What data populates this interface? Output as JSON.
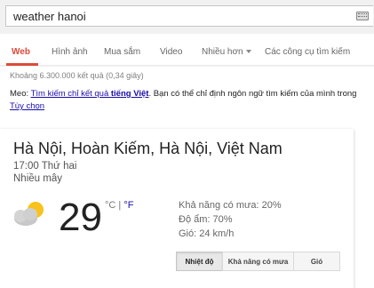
{
  "search": {
    "query": "weather hanoi"
  },
  "tabs": [
    "Web",
    "Hình ảnh",
    "Mua sắm",
    "Video",
    "Nhiều hơn",
    "Các công cụ tìm kiếm"
  ],
  "stats": "Khoảng 6.300.000 kết quả (0,34 giây)",
  "tip": {
    "prefix": "Meo: ",
    "link1": "Tìm kiếm chỉ kết quả ",
    "link1_bold": "tiếng Việt",
    "middle": ". Bạn có thể chỉ định ngôn ngữ tìm kiếm của mình trong ",
    "link2": "Tùy chọn"
  },
  "weather": {
    "location": "Hà Nội, Hoàn Kiếm, Hà Nội, Việt Nam",
    "time": "17:00 Thứ hai",
    "condition": "Nhiều mây",
    "temperature": "29",
    "unit_c": "°C",
    "unit_sep": " | ",
    "unit_f": "°F",
    "precipitation": "Khả năng có mưa: 20%",
    "humidity": "Độ ẩm: 70%",
    "wind": "Gió: 24 km/h",
    "buttons": [
      "Nhiệt độ",
      "Khả năng có mưa",
      "Gió"
    ]
  },
  "colors": {
    "accent": "#dd4b39",
    "link": "#1a0dab"
  }
}
